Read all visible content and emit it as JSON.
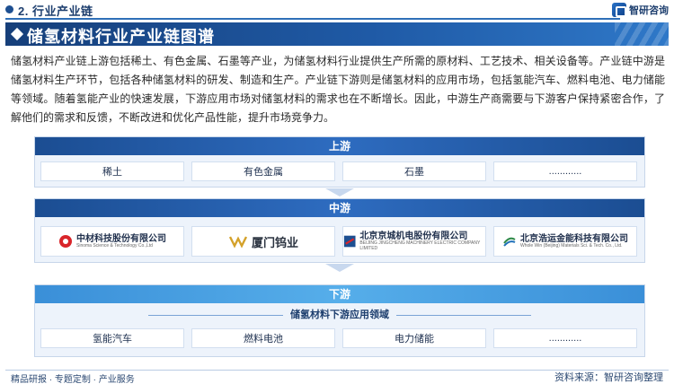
{
  "header": {
    "section_title": "2. 行业产业链",
    "brand_name": "智研咨询"
  },
  "banner": {
    "title": "储氢材料行业产业链图谱"
  },
  "intro": {
    "text": "储氢材料产业链上游包括稀土、有色金属、石墨等产业，为储氢材料行业提供生产所需的原材料、工艺技术、相关设备等。产业链中游是储氢材料生产环节，包括各种储氢材料的研发、制造和生产。产业链下游则是储氢材料的应用市场，包括氢能汽车、燃料电池、电力储能等领域。随着氢能产业的快速发展，下游应用市场对储氢材料的需求也在不断增长。因此，中游生产商需要与下游客户保持紧密合作，了解他们的需求和反馈，不断改进和优化产品性能，提升市场竞争力。"
  },
  "upstream": {
    "label": "上游",
    "items": [
      "稀土",
      "有色金属",
      "石墨",
      "............"
    ]
  },
  "midstream": {
    "label": "中游",
    "companies": [
      {
        "name": "中材科技股份有限公司",
        "name_en": "Sinoma Science & Technology Co.,Ltd"
      },
      {
        "name": "厦门钨业",
        "name_en": ""
      },
      {
        "name": "北京京城机电股份有限公司",
        "name_en": "BEIJING JINGCHENG MACHINERY ELECTRIC COMPANY LIMITED"
      },
      {
        "name": "北京浩运金能科技有限公司",
        "name_en": "Whole Win (Beijing) Materials Sci. & Tech. Co., Ltd."
      }
    ]
  },
  "downstream": {
    "label": "下游",
    "subtitle": "储氢材料下游应用领域",
    "items": [
      "氢能汽车",
      "燃料电池",
      "电力储能",
      "............"
    ]
  },
  "footer": {
    "left": "精品研报 · 专题定制 · 产业服务",
    "source": "资料来源：智研咨询整理"
  },
  "colors": {
    "primary": "#1d4f91",
    "accent": "#2f78c8",
    "panel_bg": "#edf3fb"
  }
}
